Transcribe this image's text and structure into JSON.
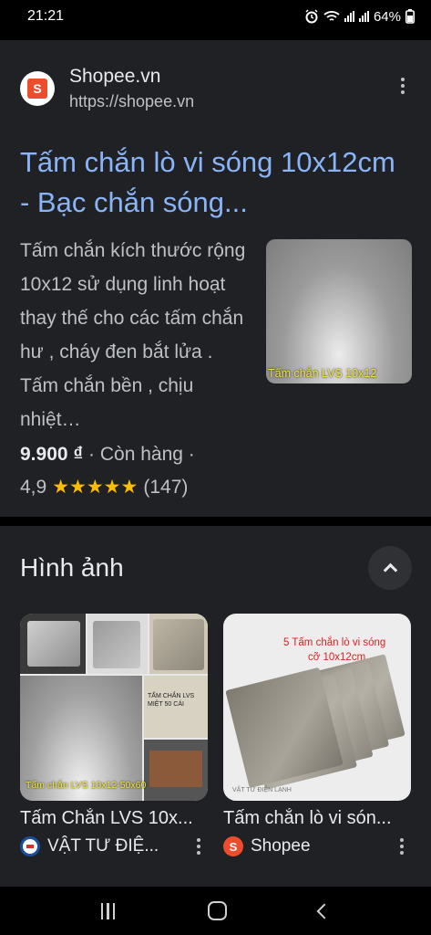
{
  "status_bar": {
    "time": "21:21",
    "battery": "64%"
  },
  "result": {
    "source_name": "Shopee.vn",
    "source_url": "https://shopee.vn",
    "title": "Tấm chắn lò vi sóng 10x12cm - Bạc chắn sóng...",
    "description": "Tấm chắn kích thước rộng 10x12 sử dụng linh hoạt thay thế cho các tấm chắn hư , cháy đen bắt lửa . Tấm chắn bền , chịu nhiệt…",
    "thumbnail_caption": "Tấm chắn LVS 10x12",
    "price": "9.900 ₫",
    "separator": "·",
    "stock": "Còn hàng",
    "rating": "4,9",
    "stars": "★★★★★",
    "rating_value": 4.9,
    "review_count": "(147)"
  },
  "images": {
    "title": "Hình ảnh",
    "items": [
      {
        "caption": "Tấm Chắn LVS 10x...",
        "source": "VẬT TƯ ĐIỆ...",
        "overlay_text": "Tấm chắn LVS  10x12-50x60",
        "label_text": "TẤM CHẮN LVS MIỆT 50 CÁI"
      },
      {
        "caption": "Tấm chắn lò vi són...",
        "source": "Shopee",
        "overlay_line1": "5 Tấm chắn lò vi sóng",
        "overlay_line2": "cỡ 10x12cm",
        "watermark": "VẬT TƯ ĐIỆN LẠNH"
      }
    ]
  },
  "colors": {
    "link": "#8ab4f8",
    "star": "#fbbc04",
    "card_bg": "#202124",
    "shopee": "#ee4d2d"
  }
}
